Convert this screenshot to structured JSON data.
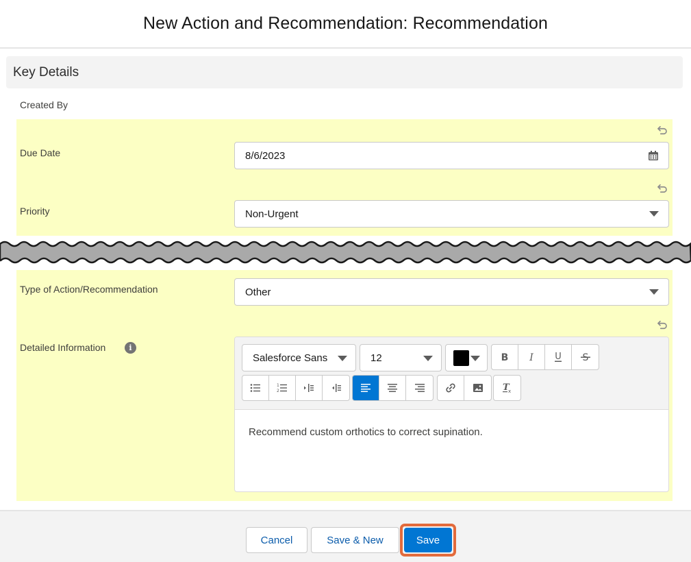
{
  "modal": {
    "title": "New Action and Recommendation: Recommendation"
  },
  "section": {
    "title": "Key Details"
  },
  "fields": {
    "created_by_label": "Created By",
    "due_date_label": "Due Date",
    "due_date_value": "8/6/2023",
    "priority_label": "Priority",
    "priority_value": "Non-Urgent",
    "type_label": "Type of Action/Recommendation",
    "type_value": "Other",
    "detailed_label": "Detailed Information"
  },
  "editor": {
    "font_family": "Salesforce Sans",
    "font_size": "12",
    "text_color": "#000000",
    "content": "Recommend custom orthotics to correct supination."
  },
  "footer": {
    "cancel_label": "Cancel",
    "save_new_label": "Save & New",
    "save_label": "Save"
  },
  "colors": {
    "highlight": "#fcffc4",
    "brand": "#0176d3",
    "save_outline": "#e36b3c"
  }
}
